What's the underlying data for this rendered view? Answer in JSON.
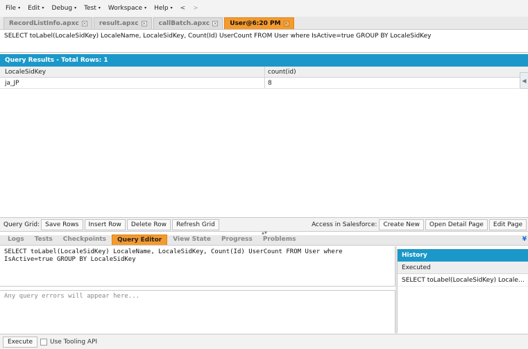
{
  "menu": [
    {
      "label": "File",
      "caret": "▾"
    },
    {
      "label": "Edit",
      "caret": "▾"
    },
    {
      "label": "Debug",
      "caret": "▾"
    },
    {
      "label": "Test",
      "caret": "▾"
    },
    {
      "label": "Workspace",
      "caret": "▾"
    },
    {
      "label": "Help",
      "caret": "▾"
    }
  ],
  "nav": {
    "back": "<",
    "forward": ">"
  },
  "tabs": [
    {
      "label": "RecordListInfo.apxc",
      "active": false
    },
    {
      "label": "result.apxc",
      "active": false
    },
    {
      "label": "callBatch.apxc",
      "active": false
    },
    {
      "label": "User@6:20 PM",
      "active": true
    }
  ],
  "query_text": "SELECT toLabel(LocaleSidKey) LocaleName, LocaleSidKey, Count(Id) UserCount FROM User where IsActive=true GROUP BY LocaleSidKey",
  "results": {
    "title": "Query Results - Total Rows: 1",
    "columns": [
      "LocaleSidKey",
      "count(id)"
    ],
    "rows": [
      [
        "ja_JP",
        "8"
      ]
    ]
  },
  "grid_toolbar": {
    "label": "Query Grid:",
    "buttons": [
      "Save Rows",
      "Insert Row",
      "Delete Row",
      "Refresh Grid"
    ],
    "sf_label": "Access in Salesforce:",
    "sf_buttons": [
      "Create New",
      "Open Detail Page",
      "Edit Page"
    ]
  },
  "panel_tabs": [
    {
      "label": "Logs",
      "active": false
    },
    {
      "label": "Tests",
      "active": false
    },
    {
      "label": "Checkpoints",
      "active": false
    },
    {
      "label": "Query Editor",
      "active": true
    },
    {
      "label": "View State",
      "active": false
    },
    {
      "label": "Progress",
      "active": false
    },
    {
      "label": "Problems",
      "active": false
    }
  ],
  "editor_text": "SELECT toLabel(LocaleSidKey) LocaleName, LocaleSidKey, Count(Id) UserCount FROM User where\nIsActive=true GROUP BY LocaleSidKey",
  "errors_placeholder": "Any query errors will appear here...",
  "history": {
    "title": "History",
    "subheader": "Executed",
    "items": [
      "SELECT toLabel(LocaleSidKey) LocaleName..."
    ]
  },
  "bottom": {
    "execute_label": "Execute",
    "tooling_label": "Use Tooling API",
    "tooling_checked": false
  },
  "colors": {
    "accent": "#f49a2e",
    "header_blue": "#1b98c9"
  }
}
